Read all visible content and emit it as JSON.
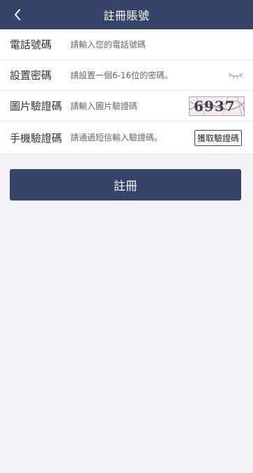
{
  "header": {
    "title": "註冊賬號",
    "back_icon": "chevron-left-icon"
  },
  "form": {
    "phone": {
      "label": "電話號碼",
      "placeholder": "請輸入您的電話號碼",
      "value": ""
    },
    "password": {
      "label": "設置密碼",
      "placeholder": "請設置一個6-16位的密碼。",
      "value": "",
      "toggle_icon": "eye-closed-icon"
    },
    "captcha": {
      "label": "圖片驗證碼",
      "placeholder": "請輸入圖片驗證碼",
      "value": "",
      "image_text": "6937"
    },
    "sms": {
      "label": "手機驗證碼",
      "placeholder": "請通過短信輸入驗證碼。",
      "value": "",
      "button_label": "獲取驗證碼"
    }
  },
  "submit_label": "註冊",
  "colors": {
    "primary": "#37446a",
    "background": "#f2f2f7"
  }
}
